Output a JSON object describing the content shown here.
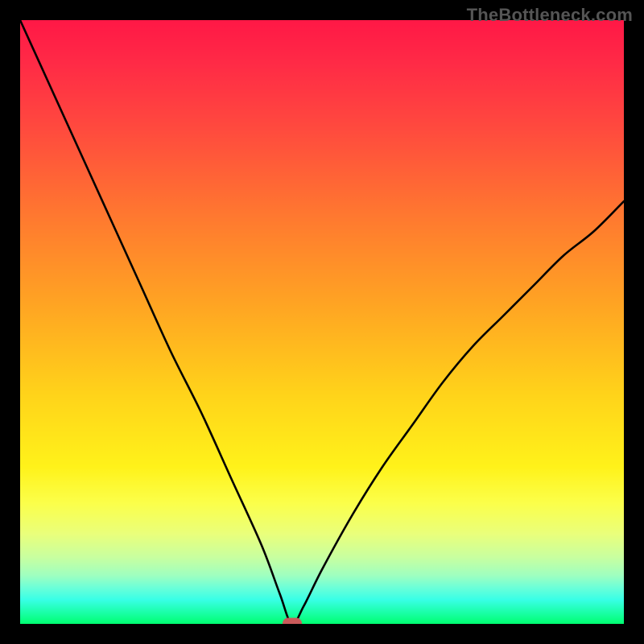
{
  "watermark": "TheBottleneck.com",
  "colors": {
    "frame": "#000000",
    "curve": "#000000",
    "marker": "#c95a5a",
    "gradient_top": "#ff1846",
    "gradient_bottom": "#00ff70"
  },
  "chart_data": {
    "type": "line",
    "title": "",
    "xlabel": "",
    "ylabel": "",
    "xlim": [
      0,
      100
    ],
    "ylim": [
      0,
      100
    ],
    "grid": false,
    "legend": false,
    "description": "Bottleneck curve: V-shaped line where the minimum (optimal/no bottleneck, green zone) occurs near x≈45. Left arm rises steeply to 100 at x=0; right arm rises to ~70 at x=100. Background is a vertical red→green gradient indicating bottleneck severity.",
    "series": [
      {
        "name": "bottleneck",
        "x": [
          0,
          5,
          10,
          15,
          20,
          25,
          30,
          35,
          40,
          43,
          45,
          47,
          50,
          55,
          60,
          65,
          70,
          75,
          80,
          85,
          90,
          95,
          100
        ],
        "values": [
          100,
          89,
          78,
          67,
          56,
          45,
          35,
          24,
          13,
          5,
          0,
          3,
          9,
          18,
          26,
          33,
          40,
          46,
          51,
          56,
          61,
          65,
          70
        ]
      }
    ],
    "marker": {
      "x": 45,
      "y": 0
    }
  }
}
